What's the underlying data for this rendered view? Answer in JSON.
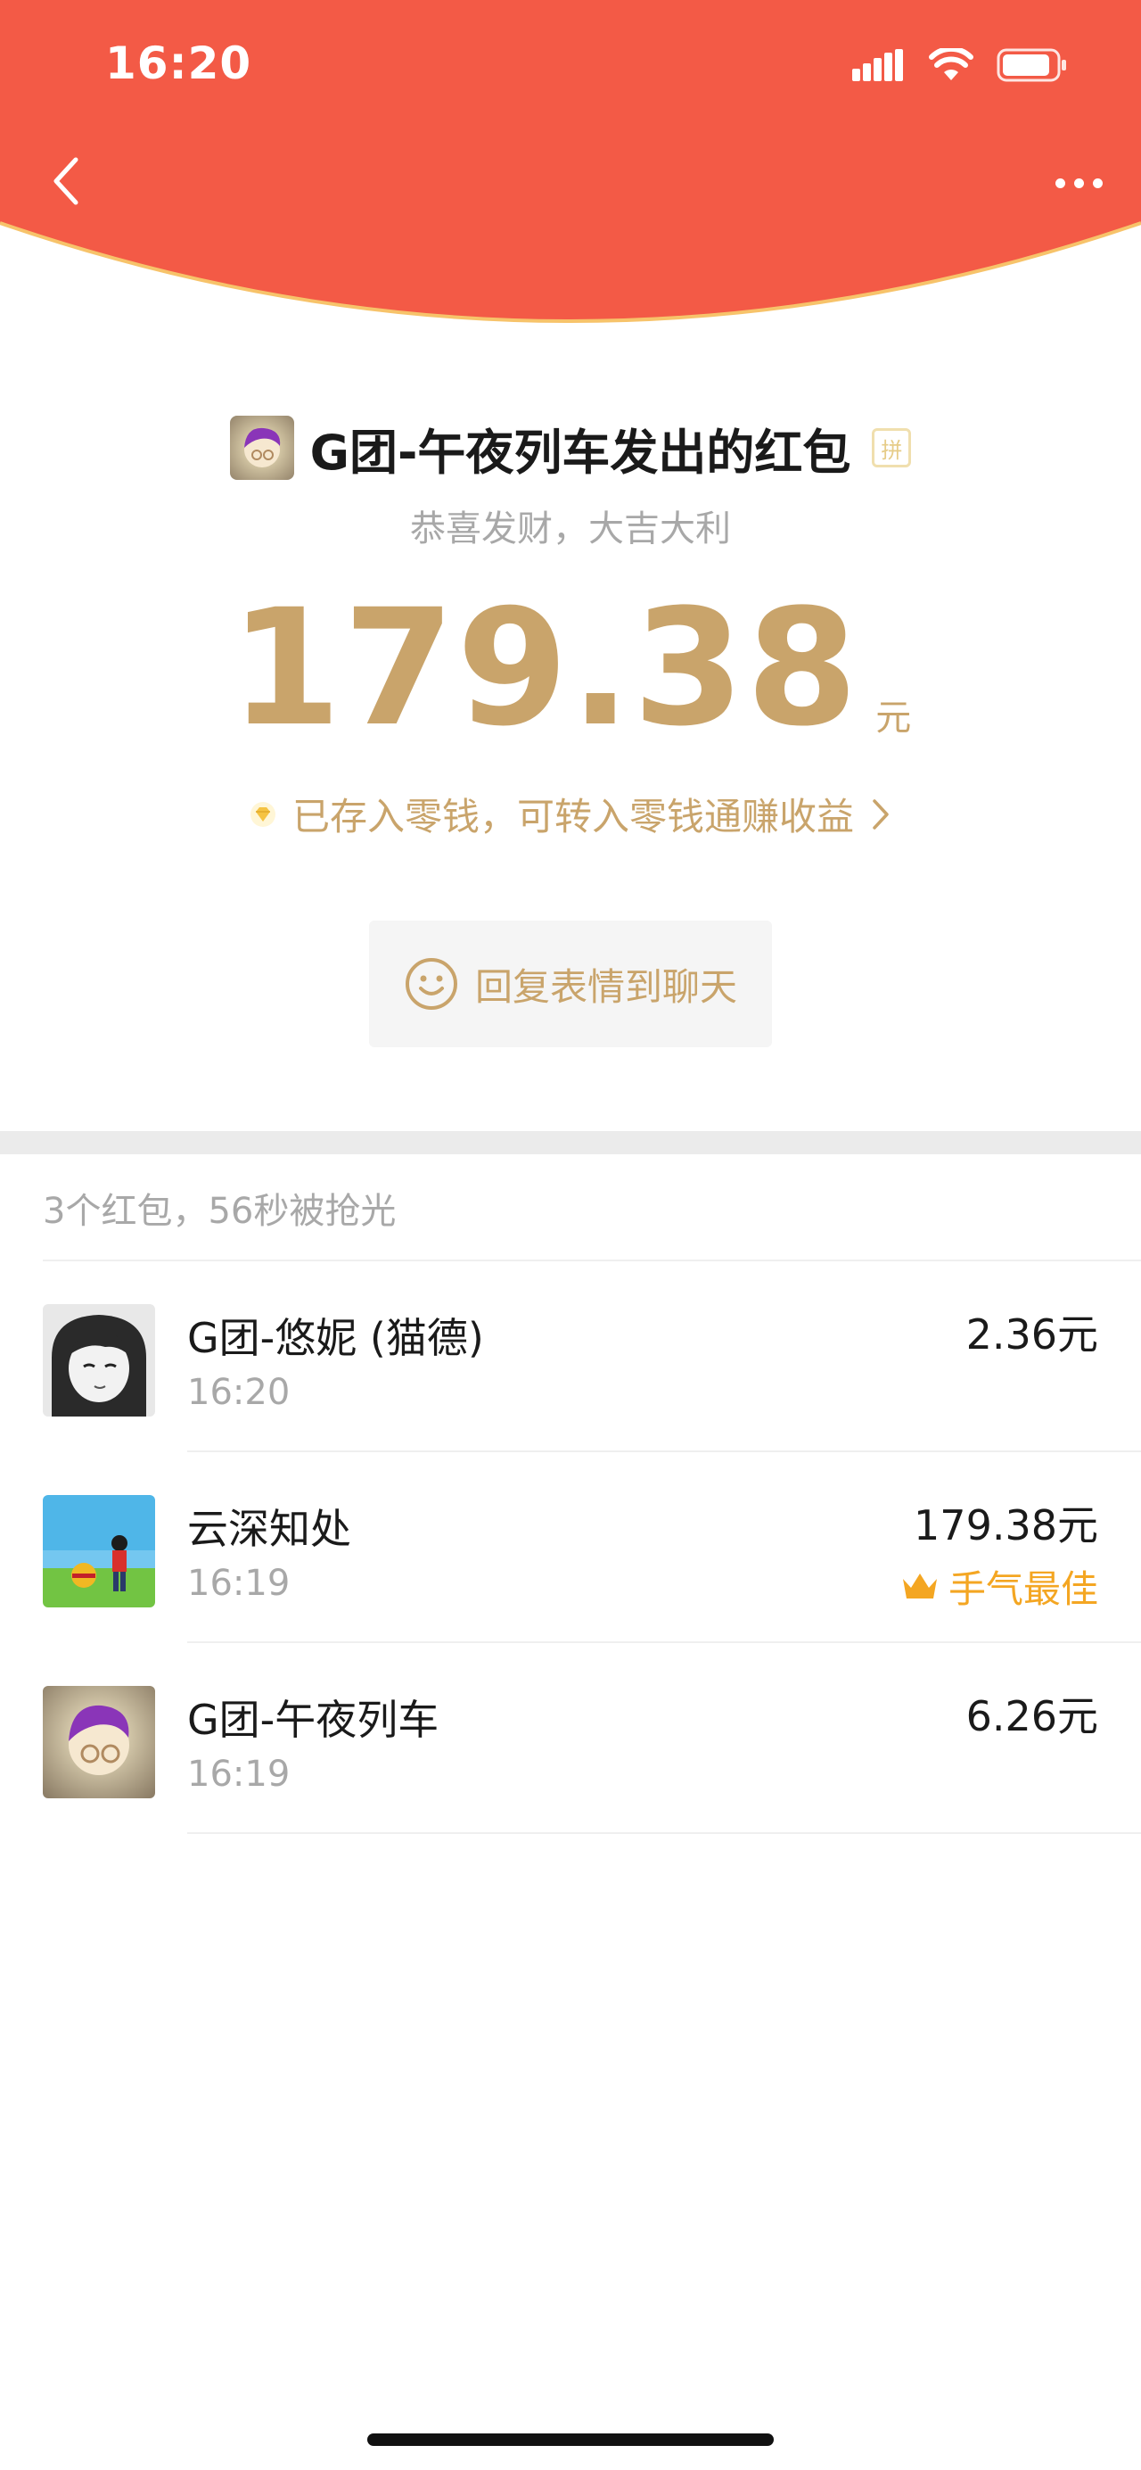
{
  "status_bar": {
    "time": "16:20"
  },
  "header": {
    "accent_color": "#f35a46",
    "back_icon": "chevron-left-icon",
    "more_icon": "more-dots-icon"
  },
  "packet": {
    "sender_title": "G团-午夜列车发出的红包",
    "pin_badge": "拼",
    "wish": "恭喜发财，大吉大利",
    "amount": "179.38",
    "unit": "元",
    "saved_text": "已存入零钱，可转入零钱通赚收益",
    "gold_color": "#c9a46b"
  },
  "reply_button": {
    "label": "回复表情到聊天"
  },
  "summary": "3个红包，56秒被抢光",
  "records": [
    {
      "name": "G团-悠妮 (猫德)",
      "time": "16:20",
      "amount": "2.36元"
    },
    {
      "name": "云深知处",
      "time": "16:19",
      "amount": "179.38元",
      "badge": "手气最佳"
    },
    {
      "name": "G团-午夜列车",
      "time": "16:19",
      "amount": "6.26元"
    }
  ]
}
